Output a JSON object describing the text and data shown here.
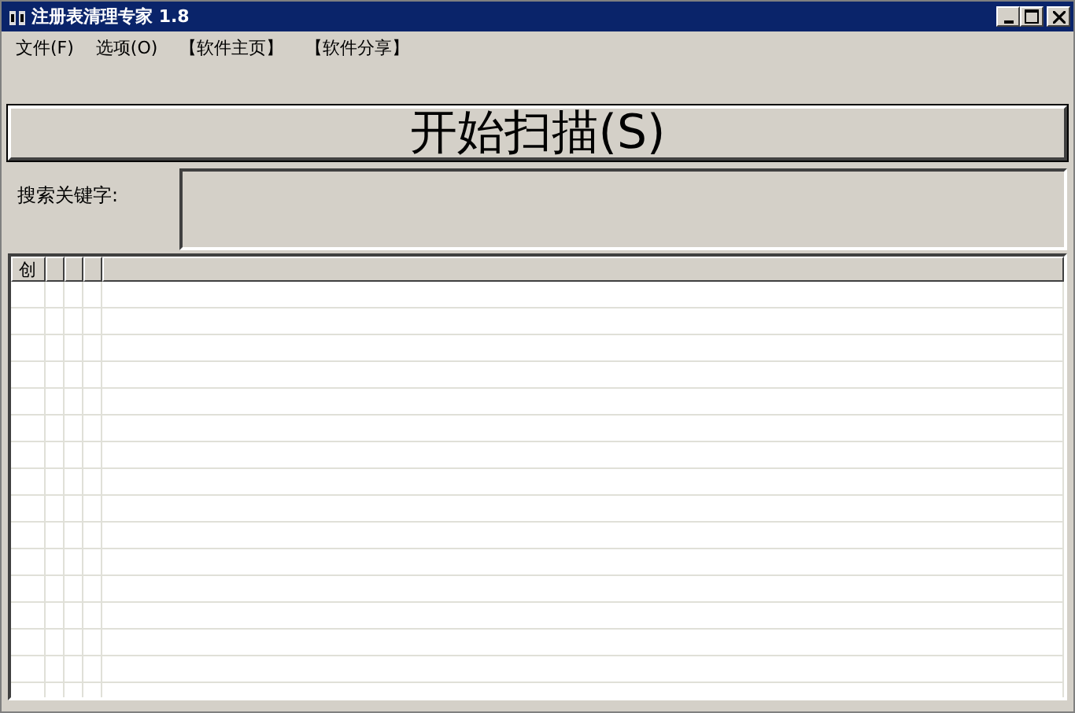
{
  "window": {
    "title": "注册表清理专家 1.8"
  },
  "menu": [
    {
      "label": "文件(F)"
    },
    {
      "label": "选项(O)"
    },
    {
      "label": "【软件主页】"
    },
    {
      "label": "【软件分享】"
    }
  ],
  "scan_button": "开始扫描(S)",
  "search": {
    "label": "搜索关键字:"
  },
  "table": {
    "columns": [
      {
        "label": "创"
      }
    ]
  }
}
